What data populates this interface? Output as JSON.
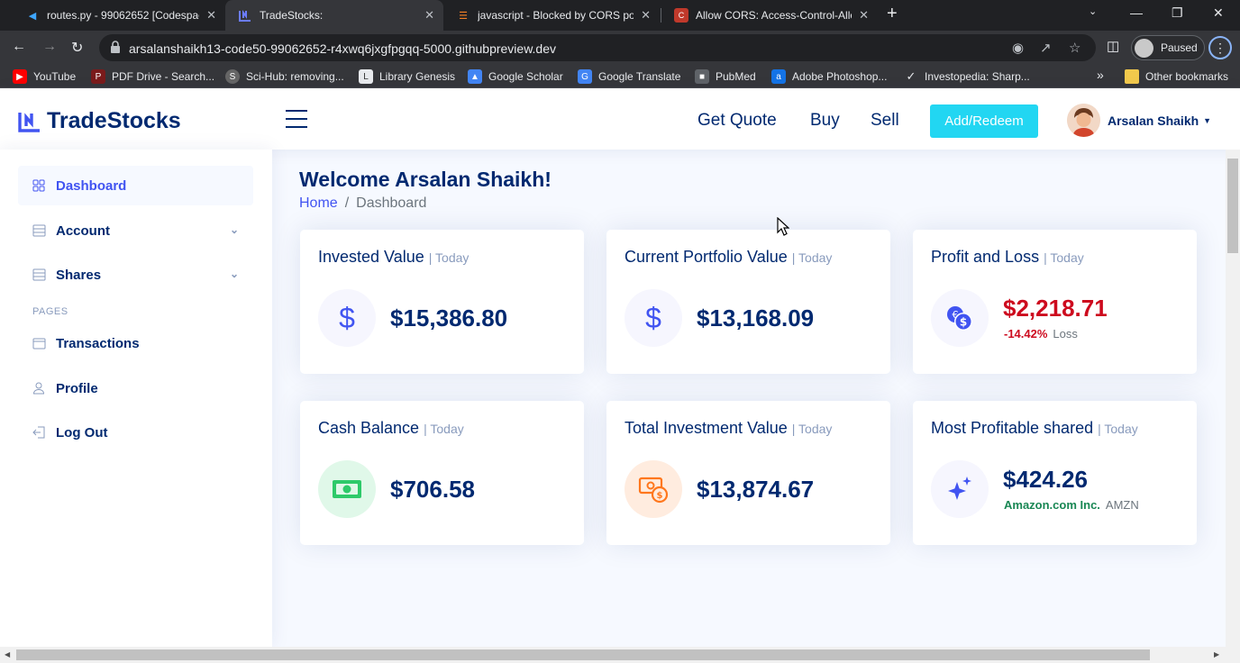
{
  "browser": {
    "tabs": [
      {
        "title": "routes.py - 99062652 [Codespace",
        "icon": "vscode-icon",
        "active": false
      },
      {
        "title": "TradeStocks:",
        "icon": "tradestocks-icon",
        "active": true
      },
      {
        "title": "javascript - Blocked by CORS poli",
        "icon": "stackoverflow-icon",
        "active": false
      },
      {
        "title": "Allow CORS: Access-Control-Allo",
        "icon": "extension-icon",
        "active": false
      }
    ],
    "url": "arsalanshaikh13-code50-99062652-r4xwq6jxgfpgqq-5000.githubpreview.dev",
    "profile_status": "Paused",
    "bookmarks": [
      {
        "label": "YouTube",
        "icon": "youtube-icon",
        "color": "#ff0000"
      },
      {
        "label": "PDF Drive - Search...",
        "icon": "pdfdrive-icon",
        "color": "#7a1b1b"
      },
      {
        "label": "Sci-Hub: removing...",
        "icon": "scihub-icon",
        "color": "#666666"
      },
      {
        "label": "Library Genesis",
        "icon": "libgen-icon",
        "color": "#e8eaed"
      },
      {
        "label": "Google Scholar",
        "icon": "scholar-icon",
        "color": "#4285f4"
      },
      {
        "label": "Google Translate",
        "icon": "translate-icon",
        "color": "#4285f4"
      },
      {
        "label": "PubMed",
        "icon": "pubmed-icon",
        "color": "#5f6368"
      },
      {
        "label": "Adobe Photoshop...",
        "icon": "adobe-icon",
        "color": "#1473e6"
      },
      {
        "label": "Investopedia: Sharp...",
        "icon": "investopedia-icon",
        "color": "#e8eaed"
      }
    ],
    "more_bookmarks": "»",
    "other_bookmarks": "Other bookmarks"
  },
  "app": {
    "brand": "TradeStocks",
    "nav": {
      "get_quote": "Get Quote",
      "buy": "Buy",
      "sell": "Sell",
      "add_redeem": "Add/Redeem"
    },
    "user_name": "Arsalan Shaikh",
    "accent": "#4154f1",
    "sidebar": {
      "dashboard": "Dashboard",
      "account": "Account",
      "shares": "Shares",
      "heading": "PAGES",
      "transactions": "Transactions",
      "profile": "Profile",
      "logout": "Log Out"
    },
    "page_title": "Welcome Arsalan Shaikh!",
    "breadcrumb": {
      "home": "Home",
      "sep": "/",
      "current": "Dashboard"
    },
    "cards": {
      "invested": {
        "title": "Invested Value",
        "sub": "| Today",
        "value": "$15,386.80",
        "icon": "dollar-icon"
      },
      "current": {
        "title": "Current Portfolio Value",
        "sub": "| Today",
        "value": "$13,168.09",
        "icon": "dollar-icon"
      },
      "pnl": {
        "title": "Profit and Loss",
        "sub": "| Today",
        "value": "$2,218.71",
        "pct": "-14.42%",
        "label": "Loss",
        "icon": "currency-exchange-icon"
      },
      "cash": {
        "title": "Cash Balance",
        "sub": "| Today",
        "value": "$706.58",
        "icon": "cash-icon"
      },
      "total": {
        "title": "Total Investment Value",
        "sub": "| Today",
        "value": "$13,874.67",
        "icon": "cash-coin-icon"
      },
      "best": {
        "title": "Most Profitable shared",
        "sub": "| Today",
        "value": "$424.26",
        "company": "Amazon.com Inc.",
        "ticker": "AMZN",
        "icon": "stars-icon"
      }
    }
  }
}
